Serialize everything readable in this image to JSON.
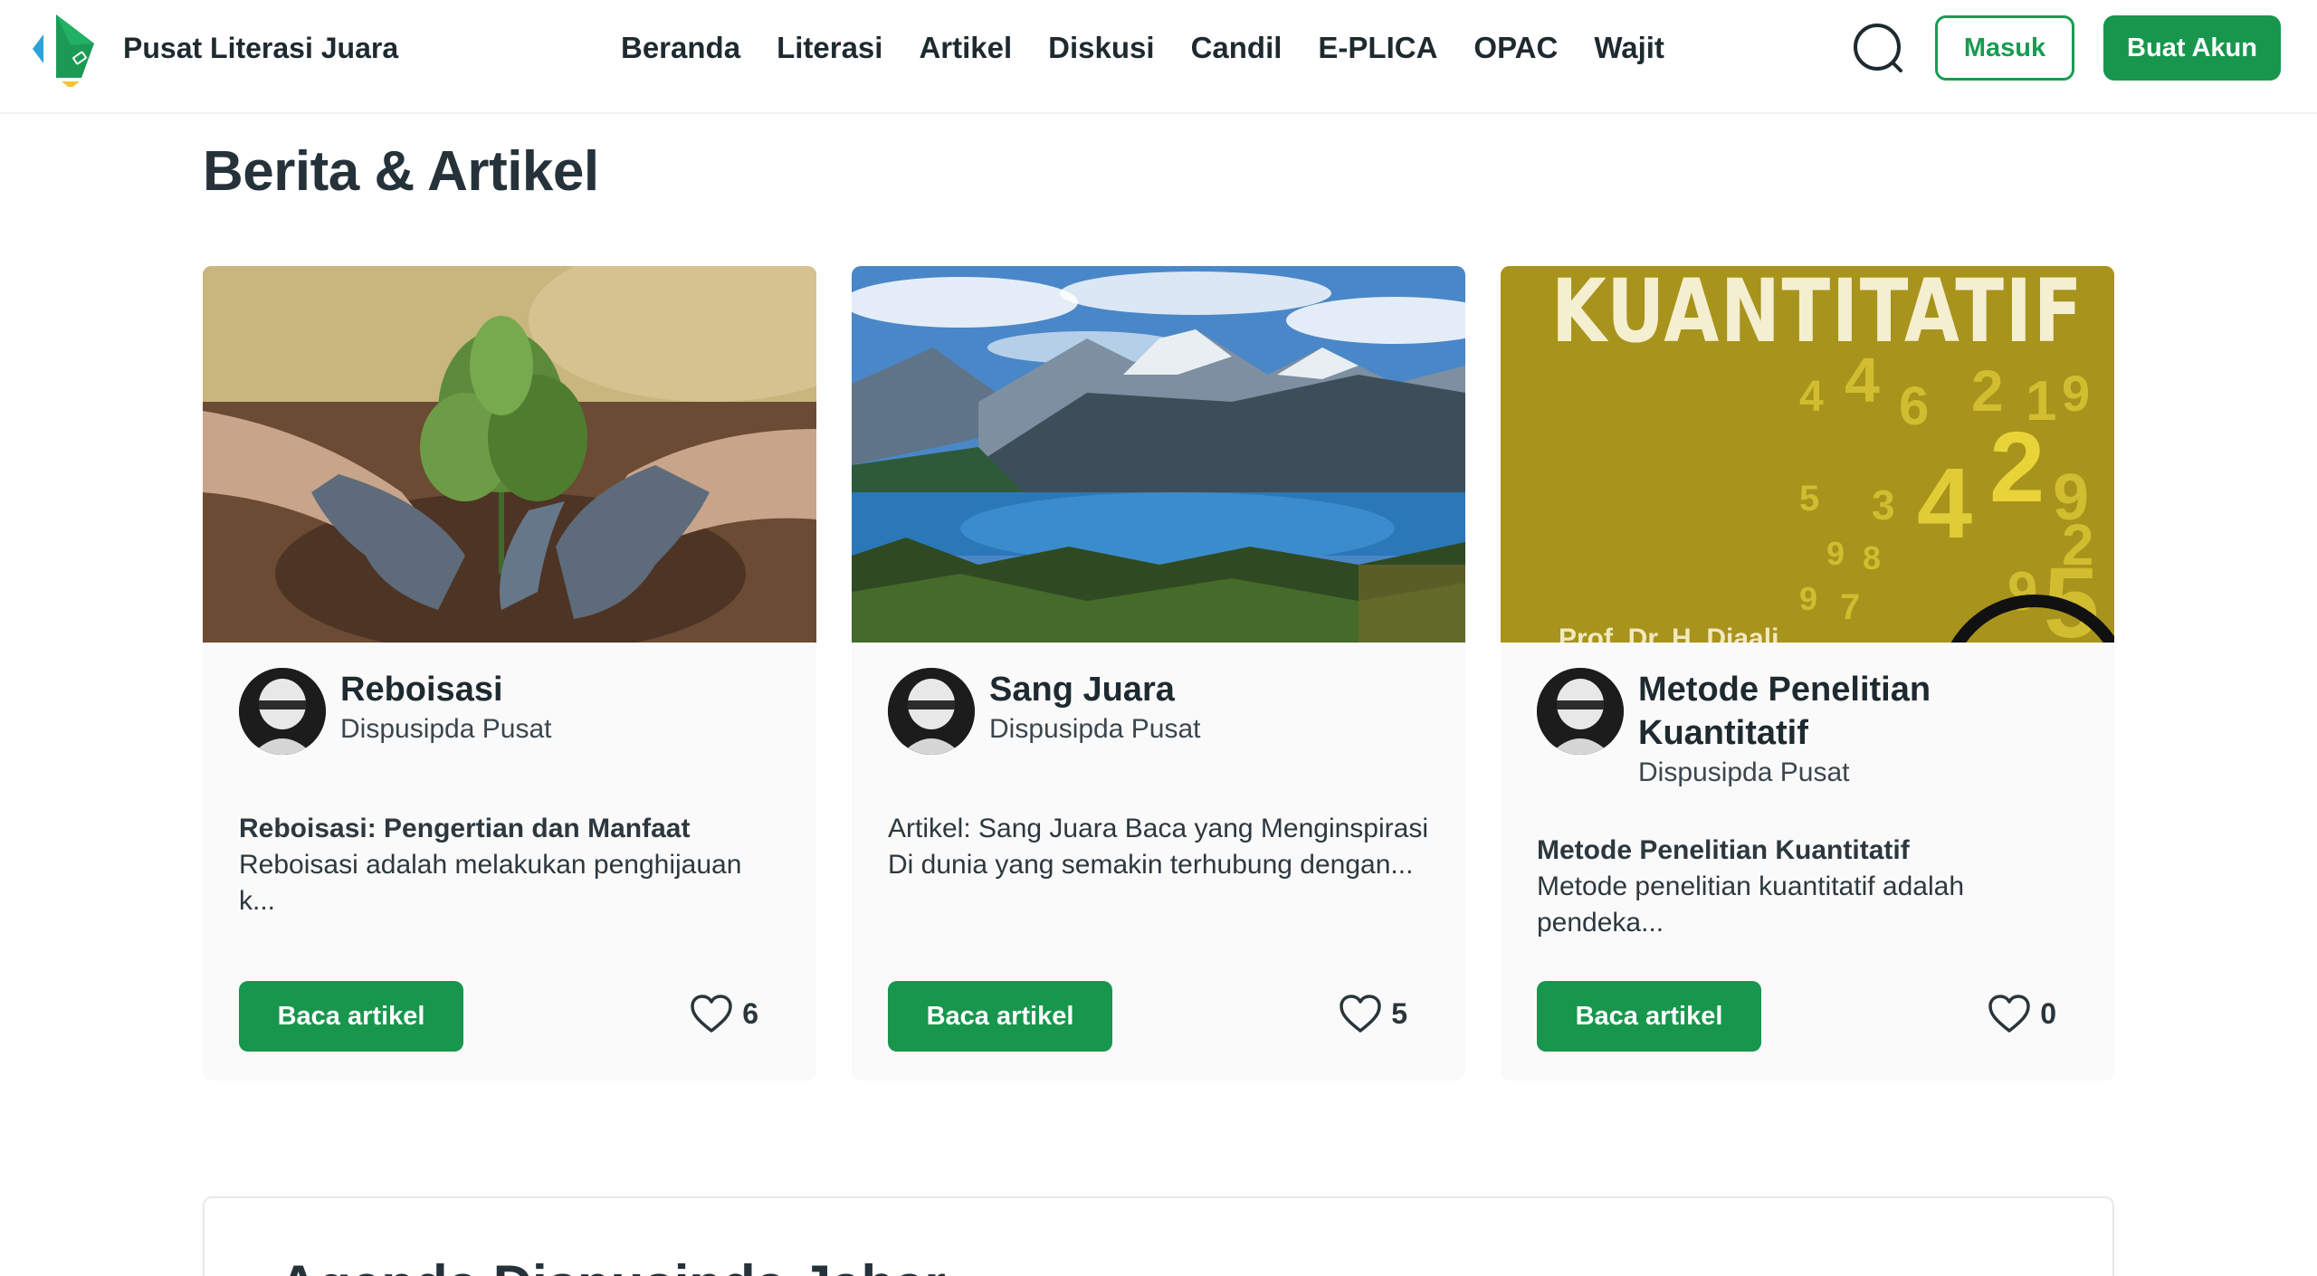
{
  "header": {
    "site_name": "Pusat Literasi Juara",
    "nav": [
      "Beranda",
      "Literasi",
      "Artikel",
      "Diskusi",
      "Candil",
      "E-PLICA",
      "OPAC",
      "Wajit"
    ],
    "login_label": "Masuk",
    "register_label": "Buat Akun",
    "icons": {
      "logo": "logo-icon",
      "search": "search-icon"
    }
  },
  "section": {
    "title": "Berita & Artikel"
  },
  "cards": [
    {
      "title": "Reboisasi",
      "author": "Dispusipda Pusat",
      "excerpt_heading": "Reboisasi: Pengertian dan Manfaat",
      "excerpt": "Reboisasi adalah melakukan penghijauan k...",
      "read_label": "Baca artikel",
      "likes": "6"
    },
    {
      "title": "Sang Juara",
      "author": "Dispusipda Pusat",
      "excerpt_heading": "",
      "excerpt": "Artikel: Sang Juara Baca yang Menginspirasi Di dunia yang semakin terhubung dengan...",
      "read_label": "Baca artikel",
      "likes": "5"
    },
    {
      "title": "Metode Penelitian Kuantitatif",
      "author": "Dispusipda Pusat",
      "excerpt_heading": "Metode Penelitian Kuantitatif",
      "excerpt": "Metode penelitian kuantitatif adalah pendeka...",
      "read_label": "Baca artikel",
      "likes": "0",
      "cover_text": "KUANTITATIF",
      "cover_author": "Prof. Dr. H. Djaali"
    }
  ],
  "agenda": {
    "title": "Agenda Dispusipda Jabar"
  },
  "colors": {
    "primary": "#18964e",
    "text": "#1e2a30",
    "card_bg": "#fafafa"
  }
}
